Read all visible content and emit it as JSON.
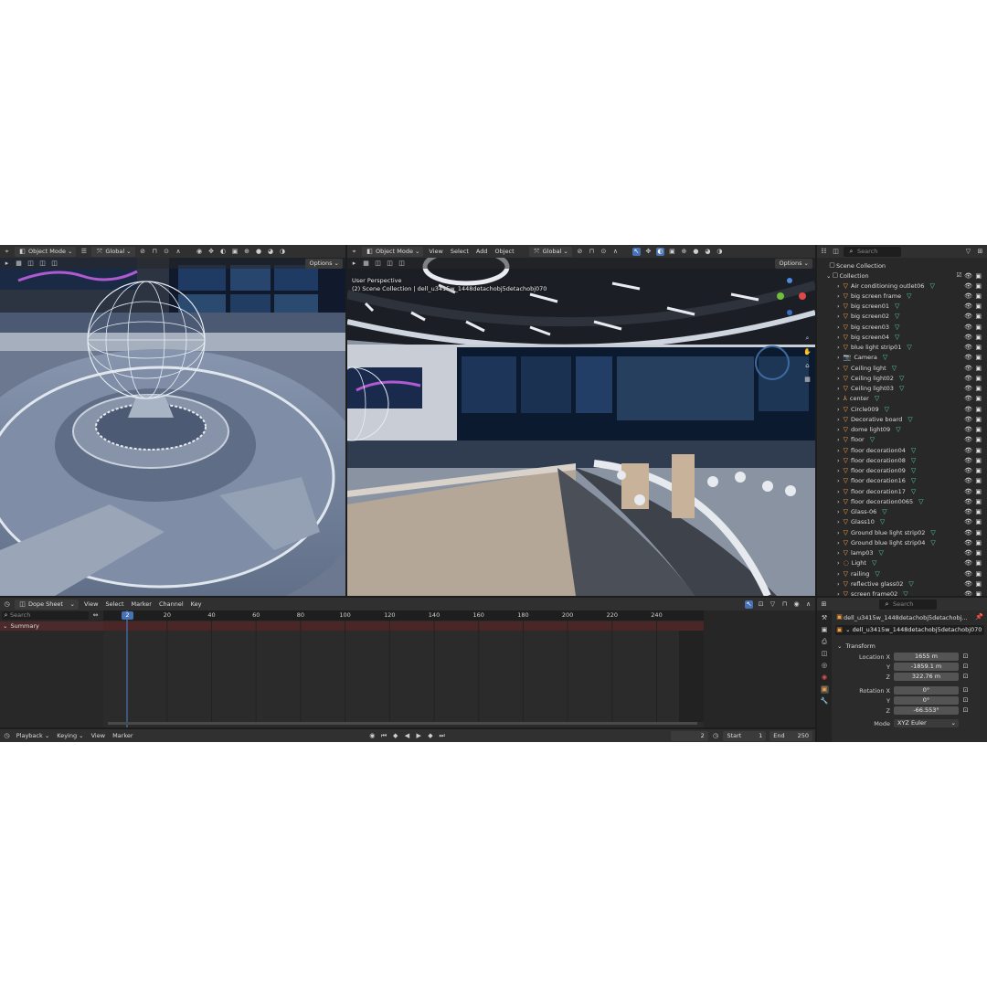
{
  "viewport_left": {
    "mode": "Object Mode",
    "orientation": "Global",
    "options": "Options"
  },
  "viewport_right": {
    "mode": "Object Mode",
    "menus": [
      "View",
      "Select",
      "Add",
      "Object"
    ],
    "orientation": "Global",
    "options": "Options",
    "overlay_line1": "User Perspective",
    "overlay_line2": "(2) Scene Collection | dell_u3415w_1448detachobj5detachobj070"
  },
  "outliner": {
    "search_placeholder": "Search",
    "scene_collection": "Scene Collection",
    "collection": "Collection",
    "items": [
      "Air conditioning outlet06",
      "big screen frame",
      "big screen01",
      "big screen02",
      "big screen03",
      "big screen04",
      "blue light strip01",
      "Camera",
      "Ceiling light",
      "Ceiling light02",
      "Ceiling light03",
      "center",
      "Circle009",
      "Decorative board",
      "dome light09",
      "floor",
      "floor decoration04",
      "floor decoration08",
      "floor decoration09",
      "floor decoration16",
      "floor decoration17",
      "floor decoration0065",
      "Glass-06",
      "Glass10",
      "Ground blue light strip02",
      "Ground blue light strip04",
      "lamp03",
      "Light",
      "railing",
      "reflective glass02",
      "screen frame02"
    ]
  },
  "dopesheet": {
    "mode": "Dope Sheet",
    "menus": [
      "View",
      "Select",
      "Marker",
      "Channel",
      "Key"
    ],
    "search_placeholder": "Search",
    "summary": "Summary",
    "current_frame": "2",
    "ticks": [
      "20",
      "40",
      "60",
      "80",
      "100",
      "120",
      "140",
      "160",
      "180",
      "200",
      "220",
      "240"
    ]
  },
  "timeline": {
    "menus": [
      "Playback",
      "Keying",
      "View",
      "Marker"
    ],
    "frame": "2",
    "start_label": "Start",
    "start": "1",
    "end_label": "End",
    "end": "250"
  },
  "properties": {
    "search_placeholder": "Search",
    "object_name": "dell_u3415w_1448detachobj5detachobj...",
    "object_field": "dell_u3415w_1448detachobj5detachobj070",
    "transform": "Transform",
    "location_label": "Location X",
    "y_label": "Y",
    "z_label": "Z",
    "rotation_label": "Rotation X",
    "loc_x": "1655 m",
    "loc_y": "-1859.1 m",
    "loc_z": "322.76 m",
    "rot_x": "0°",
    "rot_y": "0°",
    "rot_z": "-66.553°",
    "mode_label": "Mode",
    "mode_value": "XYZ Euler"
  }
}
